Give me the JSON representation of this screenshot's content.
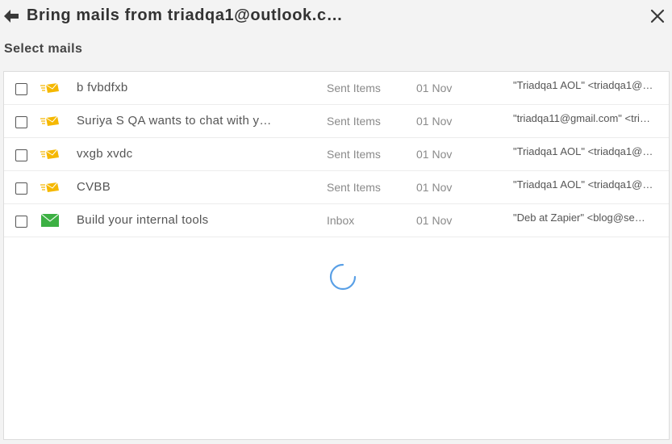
{
  "dialog": {
    "title": "Bring mails from triadqa1@outlook.c…",
    "back_icon": "arrow-left-icon",
    "close_icon": "close-icon"
  },
  "section_label": "Select mails",
  "mails": [
    {
      "subject": "b fvbdfxb",
      "folder": "Sent Items",
      "date": "01 Nov",
      "from": "\"Triadqa1 AOL\" <triadqa1@…",
      "icon": "sent-mail-icon",
      "icon_color": "#f5b800",
      "checked": false
    },
    {
      "subject": "Suriya S QA wants to chat with y…",
      "folder": "Sent Items",
      "date": "01 Nov",
      "from": "\"triadqa11@gmail.com\" <tri…",
      "icon": "sent-mail-icon",
      "icon_color": "#f5b800",
      "checked": false
    },
    {
      "subject": "vxgb xvdc",
      "folder": "Sent Items",
      "date": "01 Nov",
      "from": "\"Triadqa1 AOL\" <triadqa1@…",
      "icon": "sent-mail-icon",
      "icon_color": "#f5b800",
      "checked": false
    },
    {
      "subject": "CVBB",
      "folder": "Sent Items",
      "date": "01 Nov",
      "from": "\"Triadqa1 AOL\" <triadqa1@…",
      "icon": "sent-mail-icon",
      "icon_color": "#f5b800",
      "checked": false
    },
    {
      "subject": "Build your internal tools",
      "folder": "Inbox",
      "date": "01 Nov",
      "from": "\"Deb at Zapier\" <blog@se…",
      "icon": "inbox-mail-icon",
      "icon_color": "#3cb043",
      "checked": false
    }
  ],
  "loading": {
    "icon": "loading-spinner-icon",
    "color": "#5aa0e6"
  }
}
